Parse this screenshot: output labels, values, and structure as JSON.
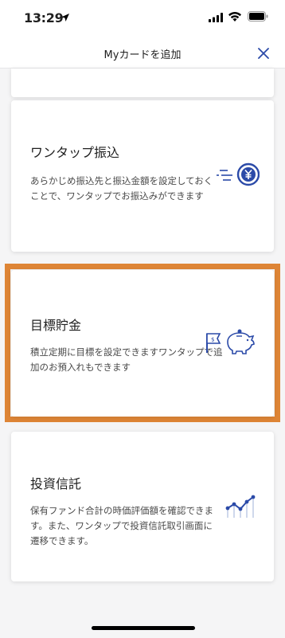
{
  "status_bar": {
    "time": "13:29"
  },
  "header": {
    "title": "Myカードを追加"
  },
  "cards": [
    {
      "title": "ワンタップ振込",
      "description": "あらかじめ振込先と振込金額を設定しておくことで、ワンタップでお振込みができます",
      "icon": "yen-coin-icon",
      "selected": false
    },
    {
      "title": "目標貯金",
      "description": "積立定期に目標を設定できますワンタップで追加のお預入れもできます",
      "icon": "piggy-bank-icon",
      "selected": true
    },
    {
      "title": "投資信託",
      "description": "保有ファンド合計の時価評価額を確認できます。また、ワンタップで投資信託取引画面に遷移できます。",
      "icon": "investment-chart-icon",
      "selected": false
    }
  ],
  "colors": {
    "accent": "#2b4aa8",
    "highlight": "#de8536",
    "background": "#f5f5f6"
  }
}
